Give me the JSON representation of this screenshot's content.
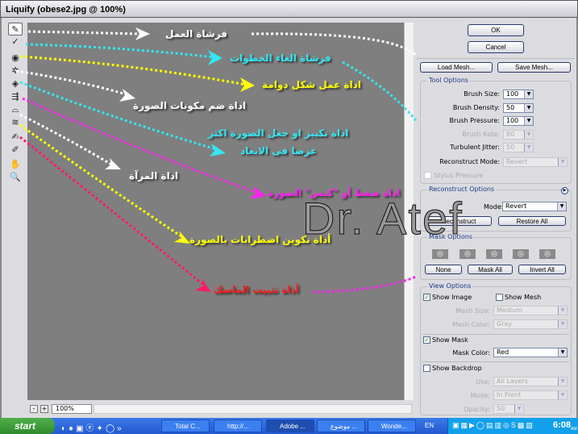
{
  "window": {
    "title": "Liquify (obese2.jpg @ 100%)"
  },
  "tools": [
    {
      "name": "forward-warp-icon",
      "glyph": "✎"
    },
    {
      "name": "reconstruct-icon",
      "glyph": "✓"
    },
    {
      "name": "twirl-icon",
      "glyph": "◉"
    },
    {
      "name": "pucker-icon",
      "glyph": "✲"
    },
    {
      "name": "bloat-icon",
      "glyph": "◈"
    },
    {
      "name": "push-left-icon",
      "glyph": "⇶"
    },
    {
      "name": "mirror-icon",
      "glyph": "⌓"
    },
    {
      "name": "turbulence-icon",
      "glyph": "≋"
    },
    {
      "name": "freeze-mask-icon",
      "glyph": "✍"
    },
    {
      "name": "thaw-mask-icon",
      "glyph": "✐"
    },
    {
      "name": "hand-icon",
      "glyph": "✋"
    },
    {
      "name": "zoom-icon",
      "glyph": "🔍"
    }
  ],
  "annotations": [
    {
      "text": "فرشاة العمل",
      "color": "#ffffff"
    },
    {
      "text": "فرشاة الغاء الخطوات",
      "color": "#33e6f0"
    },
    {
      "text": "اداة عمل شكل دوامة",
      "color": "#ffff00"
    },
    {
      "text": "اداة ضم مكونات الصورة",
      "color": "#ffffff"
    },
    {
      "text": "اداة  تكبير او جعل الصورة اكثر",
      "color": "#33e6f0"
    },
    {
      "text": "عرضا فى الابعاد",
      "color": "#33e6f0"
    },
    {
      "text": "اداة ضغط أو \"كبس\" الصورة",
      "color": "#ff22ee"
    },
    {
      "text": "اداة المرآة",
      "color": "#ffffff"
    },
    {
      "text": "أداة تكوين اضطرابات بالصورة",
      "color": "#ffff00"
    },
    {
      "text": "أداة تثبيت الماسك",
      "color": "#ff1a1a"
    }
  ],
  "watermark": "Dr. Atef",
  "bottom": {
    "zoom": "100%",
    "minus": "-",
    "plus": "+"
  },
  "panel": {
    "ok": "OK",
    "cancel": "Cancel",
    "load_mesh": "Load Mesh...",
    "save_mesh": "Save Mesh...",
    "tool_options": {
      "title": "Tool Options",
      "brush_size": {
        "label": "Brush Size:",
        "value": "100"
      },
      "brush_density": {
        "label": "Brush Density:",
        "value": "50"
      },
      "brush_pressure": {
        "label": "Brush Pressure:",
        "value": "100"
      },
      "brush_rate": {
        "label": "Brush Rate:",
        "value": "80"
      },
      "turbulent_jitter": {
        "label": "Turbulent Jitter:",
        "value": "50"
      },
      "reconstruct_mode": {
        "label": "Reconstruct Mode:",
        "value": "Revert"
      },
      "stylus_pressure": {
        "label": "Stylus Pressure",
        "checked": false
      }
    },
    "reconstruct_options": {
      "title": "Reconstruct Options",
      "mode_label": "Mode:",
      "mode": "Revert",
      "reconstruct": "Reconstruct",
      "restore_all": "Restore All"
    },
    "mask_options": {
      "title": "Mask Options",
      "none": "None",
      "mask_all": "Mask All",
      "invert_all": "Invert All"
    },
    "view_options": {
      "title": "View Options",
      "show_image": {
        "label": "Show Image",
        "checked": true
      },
      "show_mesh": {
        "label": "Show Mesh",
        "checked": false
      },
      "mesh_size": {
        "label": "Mesh Size:",
        "value": "Medium"
      },
      "mesh_color": {
        "label": "Mesh Color:",
        "value": "Gray"
      },
      "show_mask": {
        "label": "Show Mask",
        "checked": true
      },
      "mask_color": {
        "label": "Mask Color:",
        "value": "Red"
      },
      "show_backdrop": {
        "label": "Show Backdrop",
        "checked": false
      },
      "use": {
        "label": "Use:",
        "value": "All Layers"
      },
      "mode": {
        "label": "Mode:",
        "value": "In Front"
      },
      "opacity": {
        "label": "Opacity:",
        "value": "50"
      }
    }
  },
  "taskbar": {
    "start": "start",
    "tasks": [
      "Total C...",
      "http://...",
      "Adobe ...",
      "موضوع ...",
      "Wonde..."
    ],
    "active": 2,
    "lang": "EN",
    "time": "6:08",
    "ampm": "AM"
  }
}
